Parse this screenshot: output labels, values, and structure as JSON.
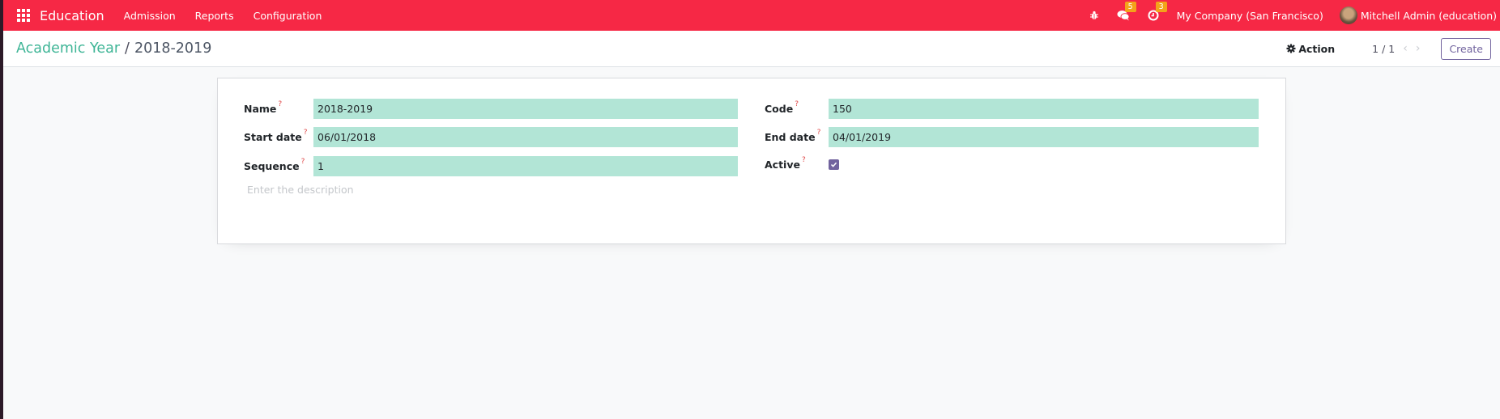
{
  "navbar": {
    "brand": "Education",
    "menus": [
      "Admission",
      "Reports",
      "Configuration"
    ],
    "messages_badge": "5",
    "activities_badge": "3",
    "company": "My Company (San Francisco)",
    "user": "Mitchell Admin (education)",
    "icons": [
      "apps-grid-icon",
      "bug-icon",
      "chat-icon",
      "clock-icon",
      "avatar"
    ]
  },
  "control_panel": {
    "breadcrumb_parent": "Academic Year",
    "breadcrumb_separator": "/",
    "breadcrumb_current": "2018-2019",
    "action_label": "Action",
    "pager_value": "1 / 1",
    "pager_prev": "‹",
    "pager_next": "›",
    "create_label": "Create"
  },
  "form": {
    "help_marker": "?",
    "fields": {
      "name": {
        "label": "Name",
        "value": "2018-2019"
      },
      "code": {
        "label": "Code",
        "value": "150"
      },
      "start_date": {
        "label": "Start date",
        "value": "06/01/2018"
      },
      "end_date": {
        "label": "End date",
        "value": "04/01/2019"
      },
      "sequence": {
        "label": "Sequence",
        "value": "1"
      },
      "active": {
        "label": "Active",
        "checked": true
      }
    },
    "description_placeholder": "Enter the description"
  },
  "colors": {
    "navbar": "#f62845",
    "breadcrumb_link": "#3eb596",
    "input_bg": "#b2e5d6",
    "primary": "#71639e",
    "badge": "#f3a31a"
  }
}
